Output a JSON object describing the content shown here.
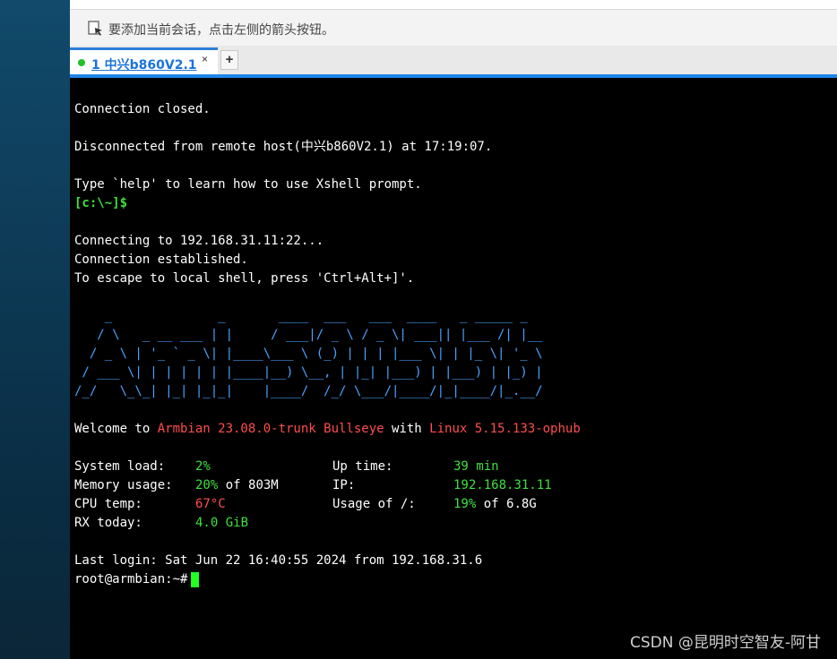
{
  "hint_bar": {
    "text": "要添加当前会话，点击左侧的箭头按钮。"
  },
  "tabs": [
    {
      "number": "1",
      "label": "中兴b860V2.1",
      "status_color": "#21c12d"
    }
  ],
  "new_tab_label": "+",
  "terminal": {
    "lines": {
      "l1": "Connection closed.",
      "l2": "Disconnected from remote host(中兴b860V2.1) at 17:19:07.",
      "l3": "Type `help' to learn how to use Xshell prompt.",
      "l4": "[c:\\~]$",
      "l5": "Connecting to 192.168.31.11:22...",
      "l6": "Connection established.",
      "l7": "To escape to local shell, press 'Ctrl+Alt+]'."
    },
    "banner": [
      "    _              _       ____  ___   ___  ____   _ _____ _",
      "   / \\   _ __ ___ | |     / ___|/ _ \\ / _ \\| ___|| |___ /| |__",
      "  / _ \\ | '_ ` _ \\| |____\\___ \\ (_) | | | |___ \\| | |_ \\| '_ \\",
      " / ___ \\| | | | | | |____|__) \\__, | |_| |___) | |___) | |_) |",
      "/_/   \\_\\_| |_| |_|_|    |____/  /_/ \\___/|____/|_|____/|_.__/"
    ],
    "welcome": {
      "prefix": "Welcome to ",
      "os": "Armbian 23.08.0-trunk Bullseye",
      "mid": " with ",
      "kernel": "Linux 5.15.133-ophub"
    },
    "stats": {
      "system_load_label": "System load:",
      "system_load": "2%",
      "uptime_label": "Up time:",
      "uptime": "39 min",
      "memory_label": "Memory usage:",
      "memory_pct": "20%",
      "memory_total": " of 803M",
      "ip_label": "IP:",
      "ip": "192.168.31.11",
      "cpu_temp_label": "CPU temp:",
      "cpu_temp": "67°C",
      "usage_label": "Usage of /:",
      "usage_pct": "19%",
      "usage_total": " of 6.8G",
      "rx_label": "RX today:",
      "rx": "4.0 GiB"
    },
    "last_login": "Last login: Sat Jun 22 16:40:55 2024 from 192.168.31.6",
    "prompt": "root@armbian:~#"
  },
  "watermark": "CSDN @昆明时空智友-阿甘"
}
